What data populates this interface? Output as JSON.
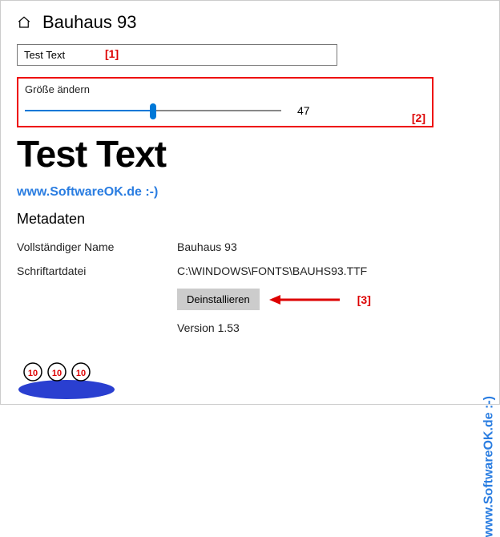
{
  "header": {
    "title": "Bauhaus 93"
  },
  "input": {
    "value": "Test Text",
    "placeholder": ""
  },
  "slider": {
    "label": "Größe ändern",
    "value": "47"
  },
  "preview": {
    "text": "Test Text"
  },
  "watermark": "www.SoftwareOK.de :-)",
  "sections": {
    "metadata_heading": "Metadaten"
  },
  "metadata": {
    "rows": [
      {
        "label": "Vollständiger Name",
        "value": "Bauhaus 93"
      },
      {
        "label": "Schriftartdatei",
        "value": "C:\\WINDOWS\\FONTS\\BAUHS93.TTF"
      }
    ],
    "uninstall_label": "Deinstallieren",
    "version_label": "Version 1.53"
  },
  "annotations": {
    "a1": "[1]",
    "a2": "[2]",
    "a3": "[3]"
  }
}
